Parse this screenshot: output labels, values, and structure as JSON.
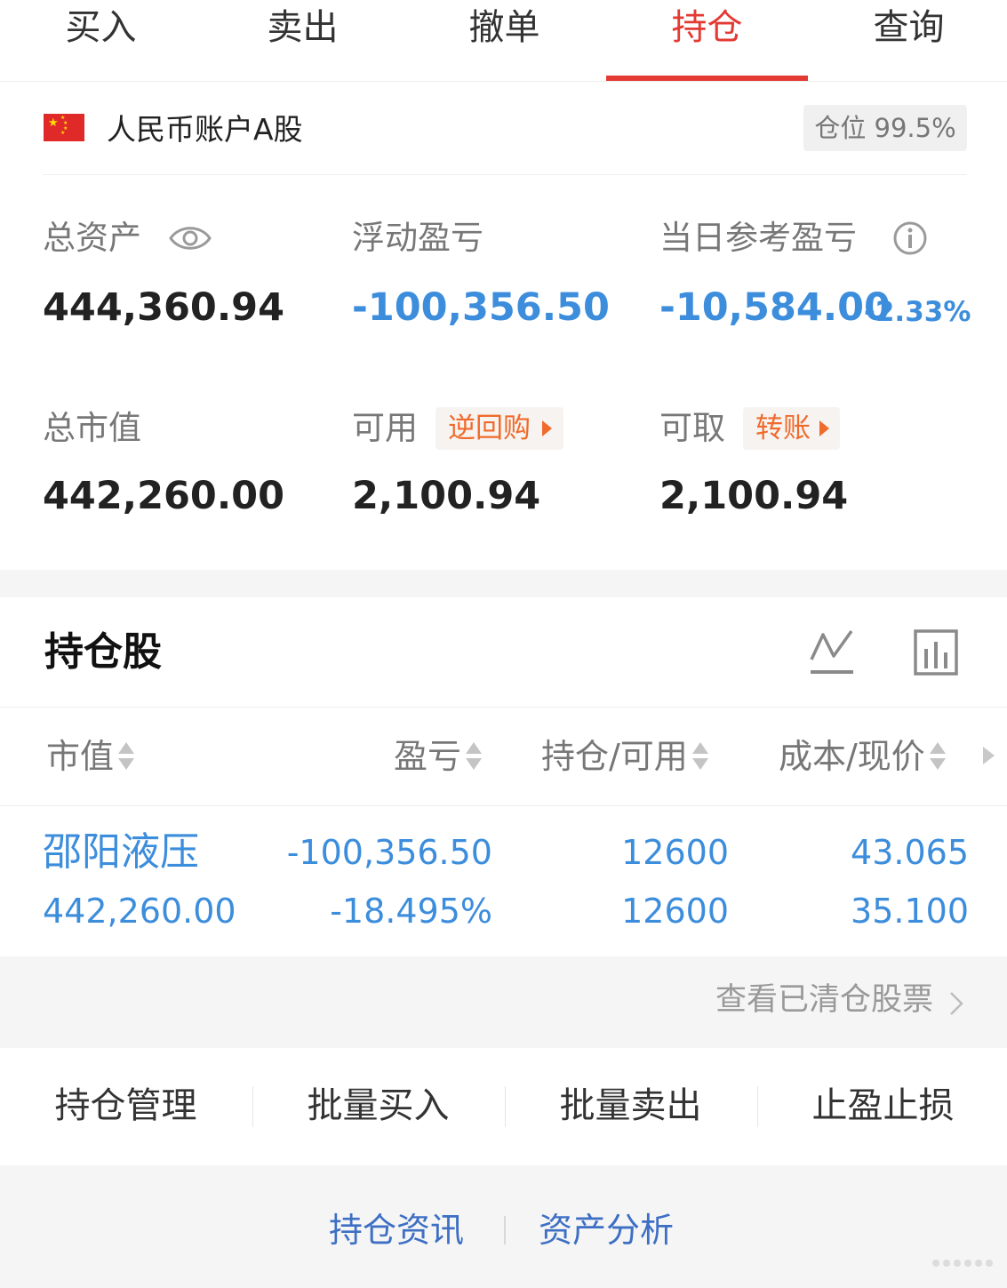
{
  "tabs": [
    {
      "label": "买入"
    },
    {
      "label": "卖出"
    },
    {
      "label": "撤单"
    },
    {
      "label": "持仓",
      "active": true
    },
    {
      "label": "查询"
    }
  ],
  "account": {
    "name": "人民币账户A股",
    "position_label": "仓位 99.5%",
    "flag_icon": "china-flag-icon"
  },
  "summary": {
    "total_assets_label": "总资产",
    "total_assets": "444,360.94",
    "floating_pl_label": "浮动盈亏",
    "floating_pl": "-100,356.50",
    "daily_pl_label": "当日参考盈亏",
    "daily_pl": "-10,584.00",
    "daily_pl_pct": "-2.33%",
    "market_value_label": "总市值",
    "market_value": "442,260.00",
    "available_label": "可用",
    "available_tag": "逆回购",
    "available": "2,100.94",
    "withdrawable_label": "可取",
    "withdrawable_tag": "转账",
    "withdrawable": "2,100.94"
  },
  "holdings": {
    "title": "持仓股",
    "columns": [
      "市值",
      "盈亏",
      "持仓/可用",
      "成本/现价"
    ],
    "rows": [
      {
        "name": "邵阳液压",
        "market_value": "442,260.00",
        "pl": "-100,356.50",
        "pl_pct": "-18.495%",
        "position": "12600",
        "available": "12600",
        "cost": "43.065",
        "price": "35.100"
      }
    ],
    "cleared_link": "查看已清仓股票"
  },
  "actions": [
    "持仓管理",
    "批量买入",
    "批量卖出",
    "止盈止损"
  ],
  "bottom_links": [
    "持仓资讯",
    "资产分析"
  ],
  "colors": {
    "accent_red": "#e33a33",
    "loss_blue": "#3c8ddc",
    "tag_orange": "#f06a2b",
    "link_blue": "#3d6fc4"
  }
}
